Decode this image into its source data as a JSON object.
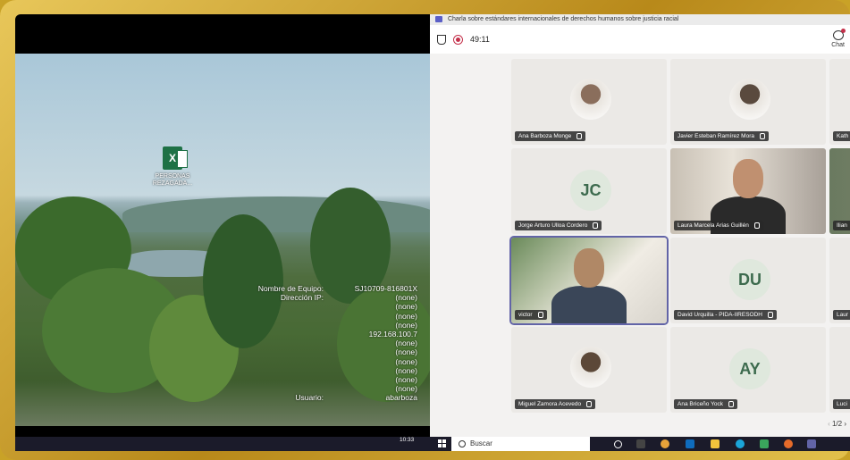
{
  "window": {
    "title": "Charla sobre estándares internacionales de derechos humanos sobre justicia racial"
  },
  "meeting": {
    "timer": "49:11",
    "chat_label": "Chat",
    "pager": "1/2"
  },
  "participants": [
    {
      "name": "Ana Barboza Monge",
      "kind": "photo"
    },
    {
      "name": "Javier Esteban Ramírez Mora",
      "kind": "photo"
    },
    {
      "name": "Kath",
      "kind": "photo"
    },
    {
      "name": "Jorge Arturo Ulloa Cordero",
      "kind": "initials",
      "initials": "JC"
    },
    {
      "name": "Laura Marcela Arias Guillén",
      "kind": "video"
    },
    {
      "name": "Ilian",
      "kind": "video"
    },
    {
      "name": "victor",
      "kind": "video"
    },
    {
      "name": "David Urquilla - PIDA-IIRESODH",
      "kind": "initials",
      "initials": "DU"
    },
    {
      "name": "Laur",
      "kind": "photo"
    },
    {
      "name": "Miguel Zamora Acevedo",
      "kind": "photo"
    },
    {
      "name": "Ana Briceño Yock",
      "kind": "initials",
      "initials": "AY"
    },
    {
      "name": "Luci",
      "kind": "photo"
    }
  ],
  "desktop": {
    "file_icon_label": "PERSONAS REZAGADA...",
    "bginfo": {
      "rows": [
        {
          "key": "Nombre de Equipo:",
          "value": "SJ10709-816801X"
        },
        {
          "key": "Dirección IP:",
          "value": "(none)"
        },
        {
          "key": "",
          "value": "(none)"
        },
        {
          "key": "",
          "value": "(none)"
        },
        {
          "key": "",
          "value": "(none)"
        },
        {
          "key": "",
          "value": "192.168.100.7"
        },
        {
          "key": "",
          "value": "(none)"
        },
        {
          "key": "",
          "value": "(none)"
        },
        {
          "key": "",
          "value": "(none)"
        },
        {
          "key": "",
          "value": "(none)"
        },
        {
          "key": "",
          "value": "(none)"
        },
        {
          "key": "",
          "value": "(none)"
        },
        {
          "key": "Usuario:",
          "value": "abarboza"
        }
      ]
    }
  },
  "taskbar": {
    "time": "10:33",
    "search_label": "Buscar"
  },
  "colors": {
    "frame": "#c9a227",
    "teams_accent": "#6264a7",
    "record": "#c4314b"
  }
}
